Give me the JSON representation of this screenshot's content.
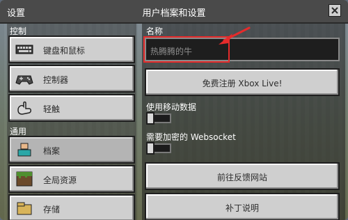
{
  "window": {
    "left_title": "设置",
    "center_title": "用户档案和设置"
  },
  "left_panel": {
    "sections": [
      {
        "label": "控制",
        "items": [
          {
            "label": "键盘和鼠标",
            "icon": "keyboard-icon"
          },
          {
            "label": "控制器",
            "icon": "gamepad-icon"
          },
          {
            "label": "轻触",
            "icon": "touch-icon"
          }
        ]
      },
      {
        "label": "通用",
        "items": [
          {
            "label": "档案",
            "icon": "profile-icon",
            "selected": true
          },
          {
            "label": "全局资源",
            "icon": "grass-block-icon"
          },
          {
            "label": "存储",
            "icon": "storage-icon"
          }
        ]
      }
    ]
  },
  "right_panel": {
    "name_label": "名称",
    "name_value": "热腾腾的牛",
    "register_label": "免费注册 Xbox Live!",
    "mobile_data_label": "使用移动数据",
    "mobile_data_on": false,
    "websocket_label": "需要加密的 Websocket",
    "websocket_on": false,
    "feedback_label": "前往反馈网站",
    "patch_notes_label": "补丁说明"
  },
  "colors": {
    "highlight": "#e62b2b",
    "button_face": "#cfcfcf",
    "top_bar": "#4a4a4a"
  }
}
